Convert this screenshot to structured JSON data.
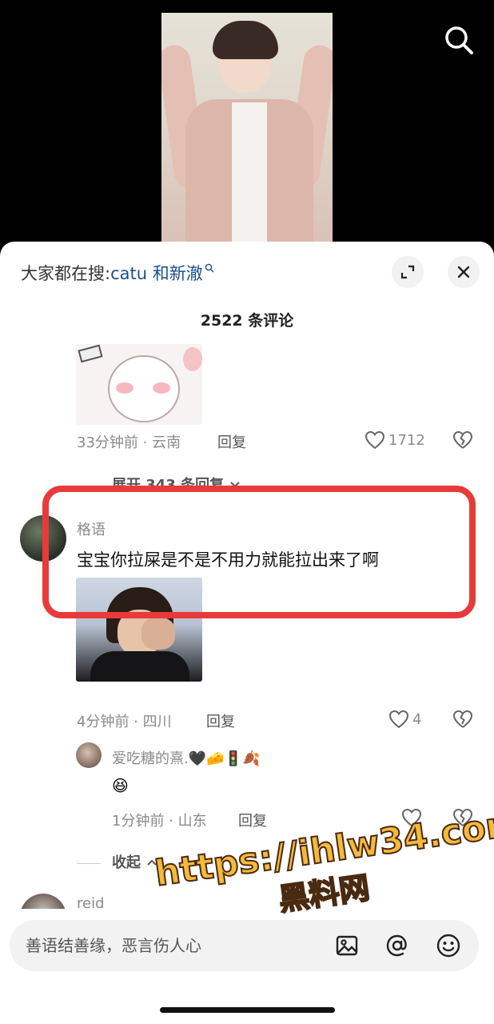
{
  "header": {
    "everyone_search_prefix": "大家都在搜:",
    "everyone_search_keyword": "catu 和新澈"
  },
  "comments_count": "2522 条评论",
  "comment1": {
    "meta": "33分钟前 · 云南",
    "reply_label": "回复",
    "likes": "1712"
  },
  "expand_replies": "展开 343 条回复",
  "comment2": {
    "username": "格语",
    "text": "宝宝你拉屎是不是不用力就能拉出来了啊",
    "meta": "4分钟前 · 四川",
    "reply_label": "回复",
    "likes": "4"
  },
  "reply1": {
    "username": "爱吃糖的熹.",
    "username_emojis": "🖤🧀🚦🍂",
    "text": "😆",
    "meta": "1分钟前 · 山东",
    "reply_label": "回复"
  },
  "collapse_label": "收起",
  "comment3": {
    "username": "reid"
  },
  "input": {
    "placeholder": "善语结善缘，恶言伤人心"
  },
  "watermark": {
    "line1": "https://ihlw34.com",
    "line2": "黑料网"
  },
  "colors": {
    "accent_link": "#1b4f8c",
    "highlight_red": "#e83a3a",
    "watermark": "#f5b93c"
  }
}
